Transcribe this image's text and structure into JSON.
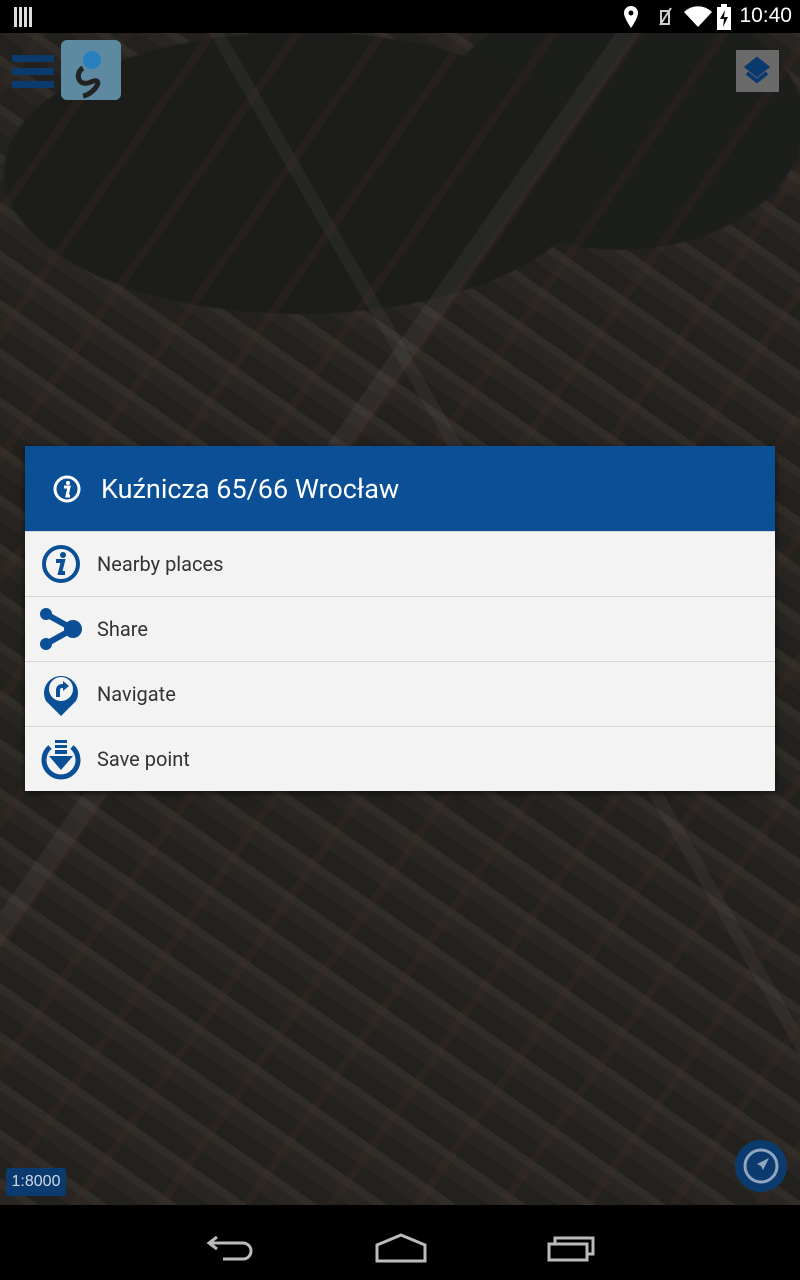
{
  "status_bar": {
    "time": "10:40",
    "icons": [
      "barcode-icon",
      "location-icon",
      "vibrate-off-icon",
      "wifi-icon",
      "battery-charging-icon"
    ]
  },
  "map": {
    "scale": "1:8000",
    "icons": [
      "menu-icon",
      "app-logo",
      "layers-icon",
      "compass-icon"
    ]
  },
  "dialog": {
    "title": "Kuźnicza 65/66 Wrocław",
    "title_icon": "info-icon",
    "items": [
      {
        "label": "Nearby places",
        "icon": "info-icon"
      },
      {
        "label": "Share",
        "icon": "share-icon"
      },
      {
        "label": "Navigate",
        "icon": "navigate-pin-icon"
      },
      {
        "label": "Save point",
        "icon": "save-download-icon"
      }
    ]
  },
  "nav_bar": {
    "icons": [
      "back-icon",
      "home-icon",
      "recents-icon"
    ]
  },
  "colors": {
    "accent": "#0b4f96",
    "dialog_bg": "#f3f3f3"
  }
}
